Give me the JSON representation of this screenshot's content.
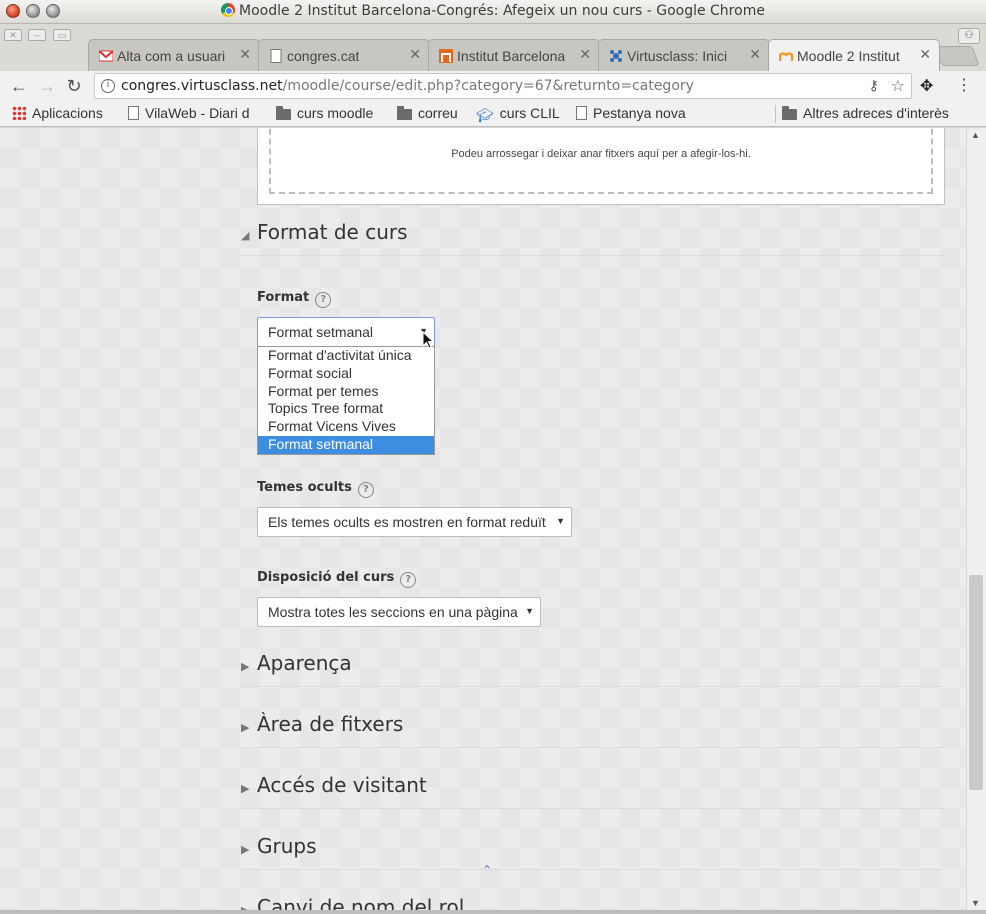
{
  "window": {
    "title": "Moodle 2 Institut Barcelona-Congrés: Afegeix un nou curs - Google Chrome"
  },
  "tabs": [
    {
      "label": "Alta com a usuari",
      "favicon": "gmail-icon"
    },
    {
      "label": "congres.cat",
      "favicon": "page-icon"
    },
    {
      "label": "Institut Barcelona",
      "favicon": "institut-icon"
    },
    {
      "label": "Virtusclass: Inici",
      "favicon": "virtusclass-icon"
    },
    {
      "label": "Moodle 2 Institut",
      "favicon": "moodle-icon",
      "active": true
    }
  ],
  "toolbar": {
    "url_host": "congres.virtusclass.net",
    "url_path": "/moodle/course/edit.php?category=67&returnto=category"
  },
  "bookmarks": [
    {
      "label": "Aplicacions",
      "icon": "apps-icon"
    },
    {
      "label": "VilaWeb - Diari d",
      "icon": "page-icon"
    },
    {
      "label": "curs moodle",
      "icon": "folder-icon"
    },
    {
      "label": "correu",
      "icon": "folder-icon"
    },
    {
      "label": "curs CLIL",
      "icon": "graduation-cap-icon"
    },
    {
      "label": "Pestanya nova",
      "icon": "page-icon"
    },
    {
      "label": "Altres adreces d'interès",
      "icon": "folder-icon"
    }
  ],
  "dropzone": {
    "text": "Podeu arrossegar i deixar anar fitxers aquí per a afegir-los-hi."
  },
  "format_section": {
    "title": "Format de curs",
    "format_label": "Format",
    "format_value": "Format setmanal",
    "format_options": [
      "Format d'activitat única",
      "Format social",
      "Format per temes",
      "Topics Tree format",
      "Format Vicens Vives",
      "Format setmanal"
    ],
    "hidden_label": "Temes ocults",
    "hidden_value": "Els temes ocults es mostren en format reduït",
    "layout_label": "Disposició del curs",
    "layout_value": "Mostra totes les seccions en una pàgina"
  },
  "collapsed_sections": [
    "Aparença",
    "Àrea de fitxers",
    "Accés de visitant",
    "Grups",
    "Canvi de nom del rol"
  ],
  "colors": {
    "selected_option": "#3d8ee1",
    "drop_arrow": "#6e86d3"
  }
}
